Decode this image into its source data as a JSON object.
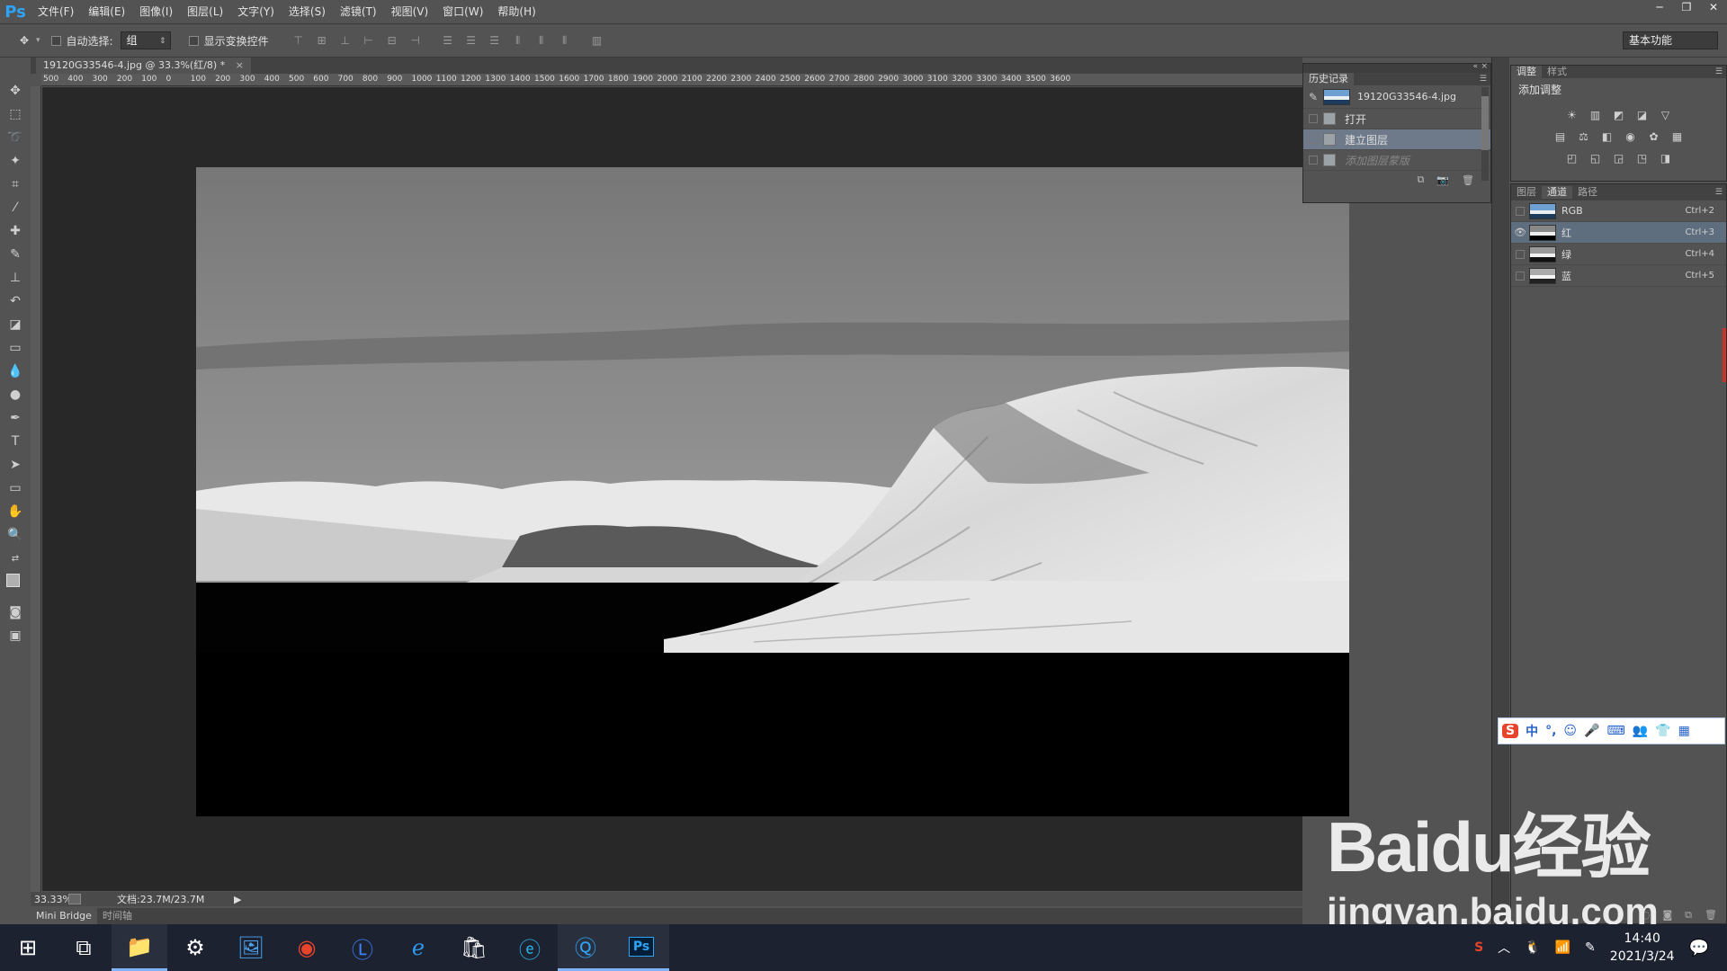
{
  "app": {
    "logo": "Ps"
  },
  "menu": [
    "文件(F)",
    "编辑(E)",
    "图像(I)",
    "图层(L)",
    "文字(Y)",
    "选择(S)",
    "滤镜(T)",
    "视图(V)",
    "窗口(W)",
    "帮助(H)"
  ],
  "window_controls": [
    "─",
    "❐",
    "✕"
  ],
  "options": {
    "auto_select_label": "自动选择:",
    "auto_select_value": "组",
    "show_transform_label": "显示变换控件",
    "workspace": "基本功能"
  },
  "document": {
    "tab_title": "19120G33546-4.jpg @ 33.3%(红/8) *",
    "zoom": "33.33%",
    "doc_size": "文档:23.7M/23.7M"
  },
  "ruler_h_labels": [
    "500",
    "400",
    "300",
    "200",
    "100",
    "0",
    "100",
    "200",
    "300",
    "400",
    "500",
    "600",
    "700",
    "800",
    "900",
    "1000",
    "1100",
    "1200",
    "1300",
    "1400",
    "1500",
    "1600",
    "1700",
    "1800",
    "1900",
    "2000",
    "2100",
    "2200",
    "2300",
    "2400",
    "2500",
    "2600",
    "2700",
    "2800",
    "2900",
    "3000",
    "3100",
    "3200",
    "3300",
    "3400",
    "3500",
    "3600"
  ],
  "bottom_tabs": [
    "Mini Bridge",
    "时间轴"
  ],
  "history": {
    "tab": "历史记录",
    "snapshot": "19120G33546-4.jpg",
    "items": [
      {
        "label": "打开",
        "state": "normal"
      },
      {
        "label": "建立图层",
        "state": "selected"
      },
      {
        "label": "添加图层蒙版",
        "state": "ghost"
      }
    ]
  },
  "adjustments": {
    "tabs": [
      "调整",
      "样式"
    ],
    "title": "添加调整",
    "row1": [
      "☀",
      "▥",
      "◩",
      "◪",
      "▽"
    ],
    "row2": [
      "▤",
      "⚖",
      "◧",
      "◉",
      "✿",
      "▦"
    ],
    "row3": [
      "◰",
      "◱",
      "◲",
      "◳",
      "◨"
    ]
  },
  "channels": {
    "tabs": [
      "图层",
      "通道",
      "路径"
    ],
    "rows": [
      {
        "name": "RGB",
        "shortcut": "Ctrl+2",
        "visible": false,
        "selected": false
      },
      {
        "name": "红",
        "shortcut": "Ctrl+3",
        "visible": true,
        "selected": true
      },
      {
        "name": "绿",
        "shortcut": "Ctrl+4",
        "visible": false,
        "selected": false
      },
      {
        "name": "蓝",
        "shortcut": "Ctrl+5",
        "visible": false,
        "selected": false
      }
    ]
  },
  "ime": {
    "items": [
      "S",
      "中",
      "°,",
      "☺",
      "🎤",
      "⌨",
      "👥",
      "👕",
      "▦"
    ]
  },
  "watermark": {
    "main": "Baidu经验",
    "url": "jingyan.baidu.com"
  },
  "taskbar": {
    "icons": [
      "start-icon",
      "task-view-icon",
      "file-explorer-icon",
      "settings-icon",
      "photos-icon",
      "chrome-icon",
      "l-app-icon",
      "ie-icon",
      "store-icon",
      "edge-icon",
      "q-browser-icon",
      "photoshop-icon"
    ],
    "time": "14:40",
    "date": "2021/3/24"
  }
}
